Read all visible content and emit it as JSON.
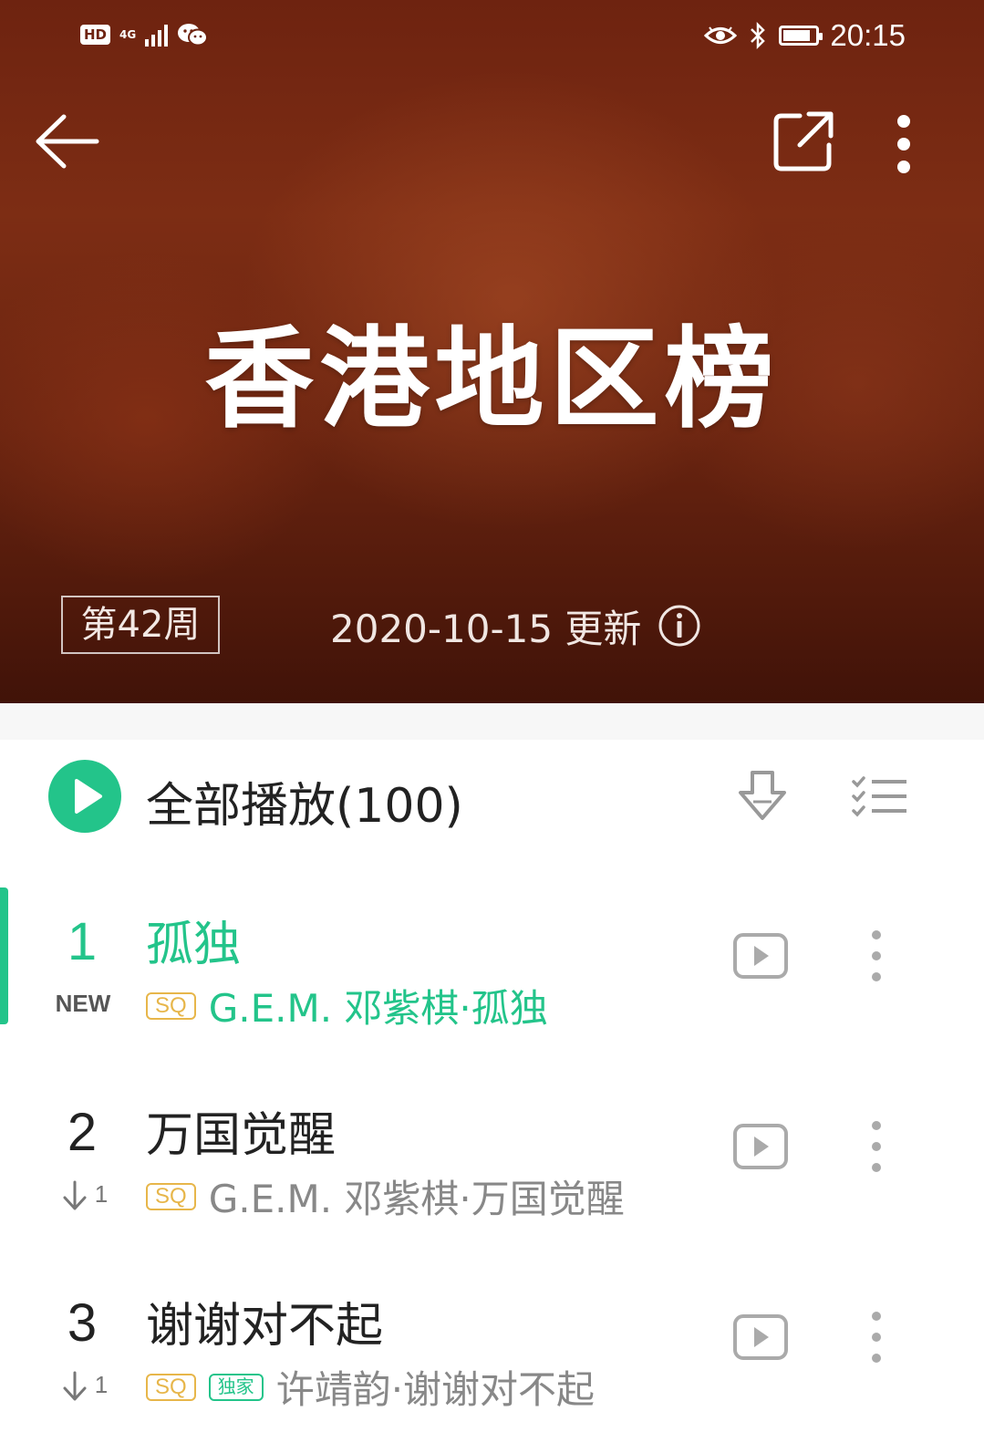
{
  "status_bar": {
    "hd": "HD",
    "network": "4G",
    "time": "20:15",
    "battery_level": 0.85
  },
  "header": {
    "title": "香港地区榜",
    "week": "第42周",
    "update": "2020-10-15 更新"
  },
  "play_all": {
    "label": "全部播放(100)"
  },
  "tags": {
    "sq": "SQ",
    "exclusive": "独家"
  },
  "songs": [
    {
      "rank": "1",
      "trend": "NEW",
      "title": "孤独",
      "artist": "G.E.M. 邓紫棋·孤独",
      "sq": true,
      "exclusive": false,
      "active": true
    },
    {
      "rank": "2",
      "trend": "1",
      "title": "万国觉醒",
      "artist": "G.E.M. 邓紫棋·万国觉醒",
      "sq": true,
      "exclusive": false,
      "active": false
    },
    {
      "rank": "3",
      "trend": "1",
      "title": "谢谢对不起",
      "artist": "许靖韵·谢谢对不起",
      "sq": true,
      "exclusive": true,
      "active": false
    }
  ],
  "colors": {
    "accent": "#23c48a",
    "sq_tag": "#e7b64a",
    "header_bg": "#6e2310",
    "text_primary": "#222222",
    "text_secondary": "#888888"
  },
  "icons": {
    "back": "back-arrow-icon",
    "share": "share-icon",
    "more": "more-vertical-icon",
    "info": "info-icon",
    "download": "download-icon",
    "multi_select": "multi-select-icon",
    "video": "video-play-icon"
  }
}
